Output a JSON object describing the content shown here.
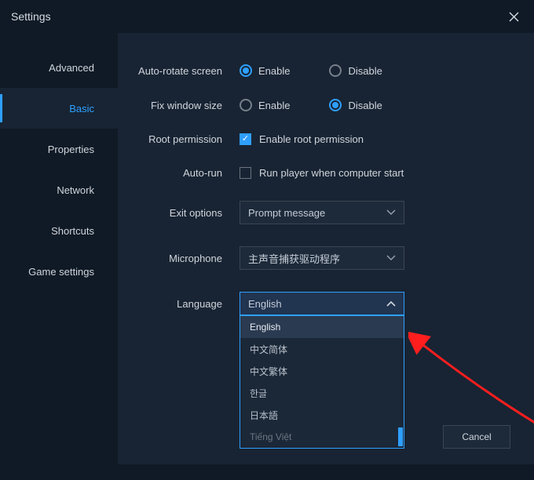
{
  "window": {
    "title": "Settings"
  },
  "sidebar": {
    "items": [
      {
        "label": "Advanced"
      },
      {
        "label": "Basic"
      },
      {
        "label": "Properties"
      },
      {
        "label": "Network"
      },
      {
        "label": "Shortcuts"
      },
      {
        "label": "Game settings"
      }
    ],
    "active_index": 1
  },
  "settings": {
    "auto_rotate": {
      "label": "Auto-rotate screen",
      "enable": "Enable",
      "disable": "Disable",
      "value": "enable"
    },
    "fix_window": {
      "label": "Fix window size",
      "enable": "Enable",
      "disable": "Disable",
      "value": "disable"
    },
    "root": {
      "label": "Root permission",
      "checkbox_label": "Enable root permission",
      "checked": true
    },
    "autorun": {
      "label": "Auto-run",
      "checkbox_label": "Run player when computer start",
      "checked": false
    },
    "exit": {
      "label": "Exit options",
      "selected": "Prompt message"
    },
    "mic": {
      "label": "Microphone",
      "selected": "主声音捕获驱动程序"
    },
    "language": {
      "label": "Language",
      "selected": "English",
      "open": true,
      "options": [
        "English",
        "中文简体",
        "中文繁体",
        "한글",
        "日本語",
        "Tiếng Việt"
      ],
      "highlighted_index": 0
    }
  },
  "buttons": {
    "cancel": "Cancel"
  }
}
